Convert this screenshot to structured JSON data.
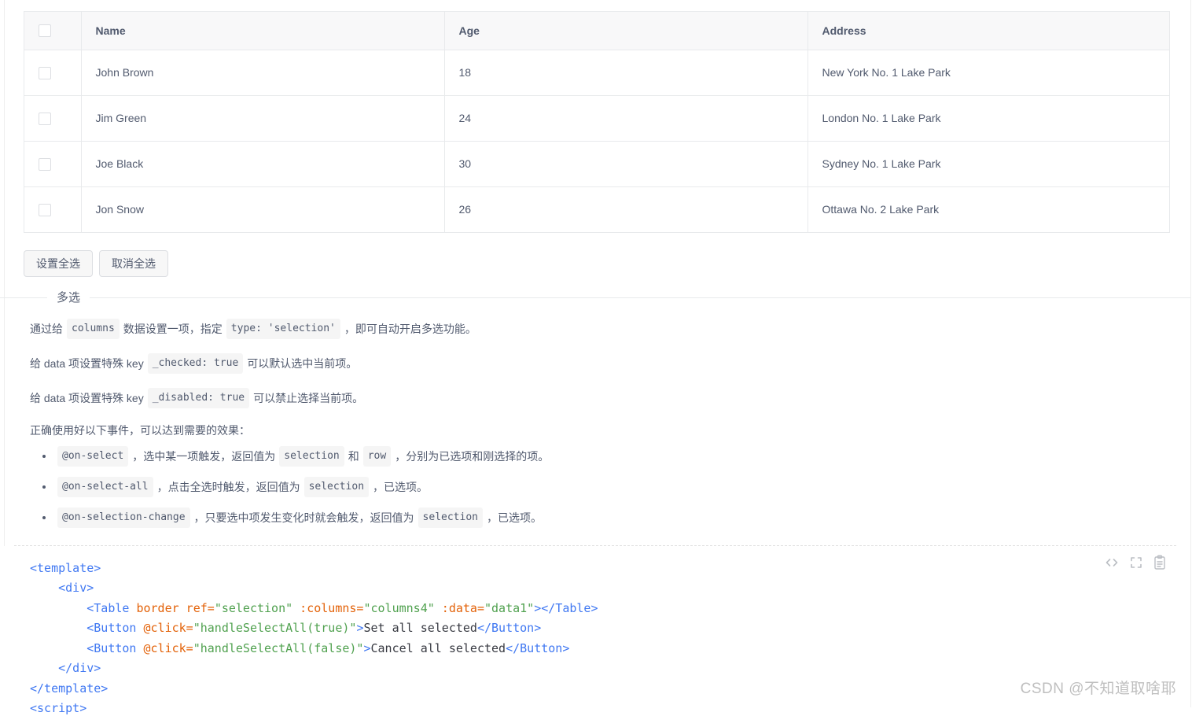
{
  "table": {
    "select_all_checkbox": "",
    "columns": [
      {
        "key": "selection",
        "label": ""
      },
      {
        "key": "name",
        "label": "Name"
      },
      {
        "key": "age",
        "label": "Age"
      },
      {
        "key": "address",
        "label": "Address"
      }
    ],
    "rows": [
      {
        "name": "John Brown",
        "age": "18",
        "address": "New York No. 1 Lake Park"
      },
      {
        "name": "Jim Green",
        "age": "24",
        "address": "London No. 1 Lake Park"
      },
      {
        "name": "Joe Black",
        "age": "30",
        "address": "Sydney No. 1 Lake Park"
      },
      {
        "name": "Jon Snow",
        "age": "26",
        "address": "Ottawa No. 2 Lake Park"
      }
    ]
  },
  "buttons": {
    "set_all_selected": "设置全选",
    "cancel_all_selected": "取消全选"
  },
  "section": {
    "legend": "多选"
  },
  "doc": {
    "line1": {
      "t1": "通过给",
      "code1": "columns",
      "t2": "数据设置一项，指定",
      "code2": "type: 'selection'",
      "t3": "，即可自动开启多选功能。"
    },
    "line2": {
      "t1": "给 data 项设置特殊 key",
      "code1": "_checked: true",
      "t2": "可以默认选中当前项。"
    },
    "line3": {
      "t1": "给 data 项设置特殊 key",
      "code1": "_disabled: true",
      "t2": "可以禁止选择当前项。"
    },
    "line4": "正确使用好以下事件，可以达到需要的效果：",
    "events": [
      {
        "code1": "@on-select",
        "t1": "，选中某一项触发，返回值为",
        "code2": "selection",
        "t2": "和",
        "code3": "row",
        "t3": "，分别为已选项和刚选择的项。"
      },
      {
        "code1": "@on-select-all",
        "t1": "，点击全选时触发，返回值为",
        "code2": "selection",
        "t2": "，已选项。"
      },
      {
        "code1": "@on-selection-change",
        "t1": "，只要选中项发生变化时就会触发，返回值为",
        "code2": "selection",
        "t2": "，已选项。"
      }
    ]
  },
  "code_block": {
    "tools": {
      "show_code": "<>",
      "fullscreen": "[ ]",
      "copy": "clipboard"
    },
    "lines": [
      [
        {
          "c": "tag",
          "t": "<template>"
        }
      ],
      [
        {
          "c": "txt",
          "t": "    "
        },
        {
          "c": "tag",
          "t": "<div>"
        }
      ],
      [
        {
          "c": "txt",
          "t": "        "
        },
        {
          "c": "tag",
          "t": "<Table "
        },
        {
          "c": "attr",
          "t": "border ref="
        },
        {
          "c": "str",
          "t": "\"selection\""
        },
        {
          "c": "attr",
          "t": " :columns="
        },
        {
          "c": "str",
          "t": "\"columns4\""
        },
        {
          "c": "attr",
          "t": " :data="
        },
        {
          "c": "str",
          "t": "\"data1\""
        },
        {
          "c": "tag",
          "t": "></Table>"
        }
      ],
      [
        {
          "c": "txt",
          "t": "        "
        },
        {
          "c": "tag",
          "t": "<Button "
        },
        {
          "c": "attr",
          "t": "@click="
        },
        {
          "c": "str",
          "t": "\"handleSelectAll(true)\""
        },
        {
          "c": "tag",
          "t": ">"
        },
        {
          "c": "txt",
          "t": "Set all selected"
        },
        {
          "c": "tag",
          "t": "</Button>"
        }
      ],
      [
        {
          "c": "txt",
          "t": "        "
        },
        {
          "c": "tag",
          "t": "<Button "
        },
        {
          "c": "attr",
          "t": "@click="
        },
        {
          "c": "str",
          "t": "\"handleSelectAll(false)\""
        },
        {
          "c": "tag",
          "t": ">"
        },
        {
          "c": "txt",
          "t": "Cancel all selected"
        },
        {
          "c": "tag",
          "t": "</Button>"
        }
      ],
      [
        {
          "c": "txt",
          "t": "    "
        },
        {
          "c": "tag",
          "t": "</div>"
        }
      ],
      [
        {
          "c": "tag",
          "t": "</template>"
        }
      ],
      [
        {
          "c": "tag",
          "t": "<script>"
        }
      ]
    ]
  },
  "watermark": "CSDN @不知道取啥耶",
  "colors": {
    "border": "#e8eaec",
    "header_bg": "#f8f8f9",
    "text": "#515a6e",
    "code_tag": "#4078f2",
    "code_attr": "#e36209",
    "code_string": "#50a14f",
    "code_text": "#383a42",
    "chip_bg": "#f5f5f5",
    "watermark": "#bfbfbf"
  }
}
